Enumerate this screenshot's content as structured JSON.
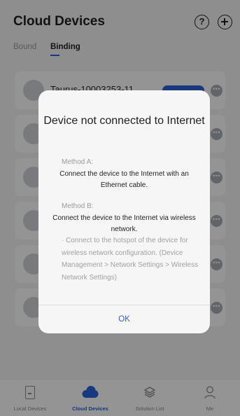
{
  "header": {
    "title": "Cloud Devices",
    "help_icon": "help-icon",
    "add_icon": "add-icon"
  },
  "tabs": [
    {
      "label": "Bound",
      "active": false
    },
    {
      "label": "Binding",
      "active": true
    }
  ],
  "devices": [
    {
      "name": "Taurus-10003253-11"
    },
    {
      "name": ""
    },
    {
      "name": ""
    },
    {
      "name": ""
    },
    {
      "name": ""
    },
    {
      "name": ""
    }
  ],
  "dialog": {
    "title": "Device not connected to Internet",
    "method_a": {
      "label": "Method A:",
      "text": "Connect the device to the Internet with an Ethernet cable."
    },
    "method_b": {
      "label": "Method B:",
      "text": "Connect the device to the Internet via wireless network.",
      "note": "· Connect to the hotspot of the device for wireless network configuration. (Device Management > Network Settings > Wireless Network Settings)"
    },
    "ok_label": "OK"
  },
  "bottom_nav": [
    {
      "label": "Local Devices",
      "icon": "local-devices-icon",
      "active": false
    },
    {
      "label": "Cloud Devices",
      "icon": "cloud-icon",
      "active": true
    },
    {
      "label": "Solution List",
      "icon": "layers-icon",
      "active": false
    },
    {
      "label": "Me",
      "icon": "person-icon",
      "active": false
    }
  ],
  "colors": {
    "accent": "#2a62d9",
    "overlay": "rgba(0,0,0,0.42)",
    "dialog_bg": "#f6f6f6"
  }
}
